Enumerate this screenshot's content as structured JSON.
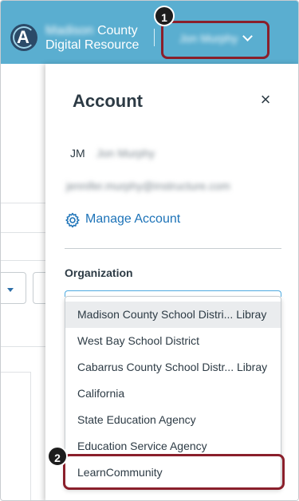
{
  "header": {
    "org_name_line1_blurred": "Madison",
    "org_name_line1_rest": "County",
    "org_name_line2": "Digital Resource",
    "logo_letter": "A",
    "user_name": "Jon Murphy"
  },
  "callouts": {
    "first": "1",
    "second": "2"
  },
  "tray": {
    "title": "Account",
    "close_glyph": "×",
    "initials": "JM",
    "full_name": "Jon Murphy",
    "email": "jennifer.murphy@instructure.com",
    "manage_account_label": "Manage Account",
    "organization_label": "Organization"
  },
  "dropdown": {
    "options": [
      "Madison County School Distri... Libray",
      "West Bay School District",
      "Cabarrus County School Distr... Libray",
      "California",
      "State Education Agency",
      "Education Service Agency",
      "LearnCommunity"
    ],
    "hovered_index": 0
  },
  "colors": {
    "header_bg": "#5aaed0",
    "link": "#1d73b8",
    "callout_border": "#8a1f2b"
  }
}
